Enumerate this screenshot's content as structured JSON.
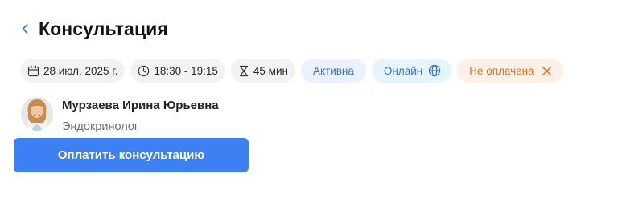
{
  "header": {
    "title": "Консультация",
    "back_icon": "chevron-left-icon"
  },
  "chips": {
    "date": {
      "icon": "calendar-icon",
      "label": "28 июл. 2025 г."
    },
    "time": {
      "icon": "clock-icon",
      "label": "18:30 - 19:15"
    },
    "duration": {
      "icon": "hourglass-icon",
      "label": "45 мин"
    },
    "status": {
      "label": "Активна"
    },
    "format": {
      "label": "Онлайн",
      "icon": "globe-icon"
    },
    "payment": {
      "label": "Не оплачена",
      "icon": "close-icon"
    }
  },
  "doctor": {
    "name": "Мурзаева Ирина Юрьевна",
    "specialty": "Эндокринолог"
  },
  "actions": {
    "pay_label": "Оплатить консультацию"
  },
  "colors": {
    "accent": "#3d80f4",
    "status_text": "#3a6ee8",
    "unpaid_text": "#ef6a1e",
    "unpaid_bg": "#fdf1e7",
    "online_bg": "#e6f4fb",
    "status_bg": "#ebf1fe",
    "chip_bg": "#f2f2f3"
  }
}
